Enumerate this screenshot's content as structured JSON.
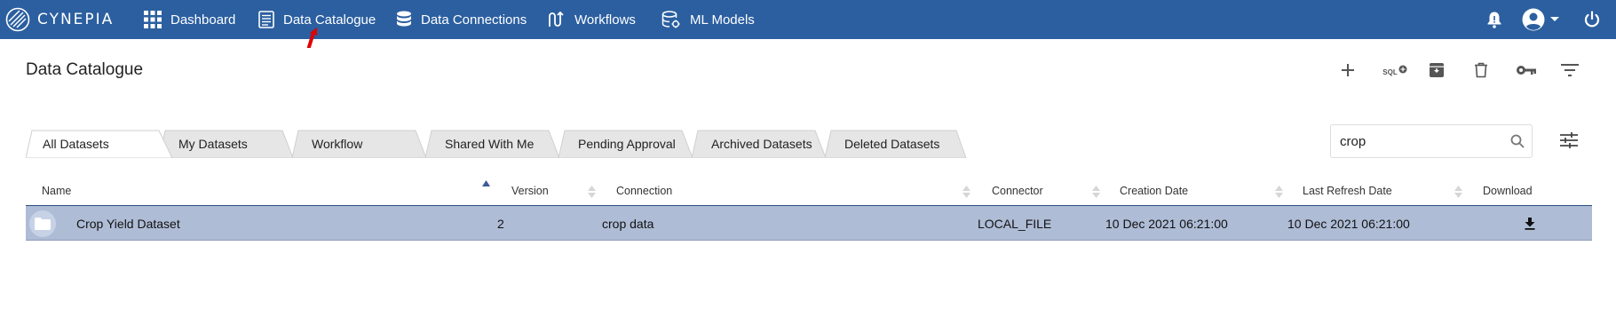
{
  "app": {
    "brand": "CYNEPIA"
  },
  "nav": {
    "items": [
      {
        "label": "Dashboard",
        "icon": "grid-icon"
      },
      {
        "label": "Data Catalogue",
        "icon": "document-list-icon"
      },
      {
        "label": "Data Connections",
        "icon": "database-icon"
      },
      {
        "label": "Workflows",
        "icon": "workflow-icon"
      },
      {
        "label": "ML Models",
        "icon": "ml-database-icon"
      }
    ],
    "right_icons": [
      "notification-bell-icon",
      "user-account-icon",
      "power-icon"
    ]
  },
  "page": {
    "title": "Data Catalogue"
  },
  "toolbar": {
    "icons": [
      "add-icon",
      "sql-add-icon",
      "archive-icon",
      "delete-icon",
      "key-icon",
      "filter-list-icon"
    ],
    "sql_label": "SQL"
  },
  "tabs": [
    {
      "label": "All Datasets",
      "active": true
    },
    {
      "label": "My Datasets",
      "active": false
    },
    {
      "label": "Workflow",
      "active": false
    },
    {
      "label": "Shared With Me",
      "active": false
    },
    {
      "label": "Pending Approval",
      "active": false
    },
    {
      "label": "Archived Datasets",
      "active": false
    },
    {
      "label": "Deleted Datasets",
      "active": false
    }
  ],
  "search": {
    "value": "crop",
    "placeholder": ""
  },
  "table": {
    "columns": [
      "Name",
      "Version",
      "Connection",
      "Connector",
      "Creation Date",
      "Last Refresh Date",
      "Download"
    ],
    "sorted_column": "Name",
    "rows": [
      {
        "name": "Crop Yield Dataset",
        "version": "2",
        "connection": "crop data",
        "connector": "LOCAL_FILE",
        "creation_date": "10 Dec 2021 06:21:00",
        "last_refresh_date": "10 Dec 2021 06:21:00",
        "selected": true
      }
    ]
  },
  "colors": {
    "navbar": "#2b5fa0",
    "selected_row": "#aebcd6",
    "annotation_arrow": "#e00000"
  }
}
